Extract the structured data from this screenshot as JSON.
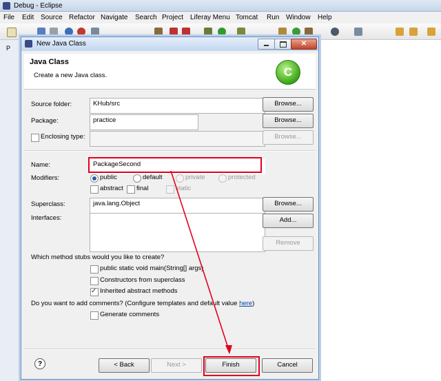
{
  "window": {
    "title": "Debug - Eclipse",
    "menu": [
      "File",
      "Edit",
      "Source",
      "Refactor",
      "Navigate",
      "Search",
      "Project",
      "Liferay Menu",
      "Tomcat",
      "Run",
      "Window",
      "Help"
    ],
    "left_tab_label": "P"
  },
  "dialog": {
    "title": "New Java Class",
    "heading": "Java Class",
    "subheading": "Create a new Java class.",
    "source_folder": {
      "label": "Source folder:",
      "value": "KHub/src",
      "button": "Browse..."
    },
    "package": {
      "label": "Package:",
      "value": "practice",
      "button": "Browse..."
    },
    "enclosing_type": {
      "label": "Enclosing type:",
      "value": "",
      "button": "Browse...",
      "checked": false
    },
    "name": {
      "label": "Name:",
      "value": "PackageSecond"
    },
    "modifiers": {
      "label": "Modifiers:",
      "radios": [
        {
          "label": "public",
          "selected": true,
          "enabled": true
        },
        {
          "label": "default",
          "selected": false,
          "enabled": true
        },
        {
          "label": "private",
          "selected": false,
          "enabled": false
        },
        {
          "label": "protected",
          "selected": false,
          "enabled": false
        }
      ],
      "checks": [
        {
          "label": "abstract",
          "checked": false,
          "enabled": true
        },
        {
          "label": "final",
          "checked": false,
          "enabled": true
        },
        {
          "label": "static",
          "checked": false,
          "enabled": false
        }
      ]
    },
    "superclass": {
      "label": "Superclass:",
      "value": "java.lang.Object",
      "button": "Browse..."
    },
    "interfaces": {
      "label": "Interfaces:",
      "add_button": "Add...",
      "remove_button": "Remove"
    },
    "stubs": {
      "question": "Which method stubs would you like to create?",
      "options": [
        {
          "label": "public static void main(String[] args)",
          "checked": false
        },
        {
          "label": "Constructors from superclass",
          "checked": false
        },
        {
          "label": "Inherited abstract methods",
          "checked": true
        }
      ]
    },
    "comments": {
      "question": "Do you want to add comments? (Configure templates and default value ",
      "link": "here",
      "question_end": ")",
      "option": {
        "label": "Generate comments",
        "checked": false
      }
    },
    "buttons": {
      "help": "?",
      "back": "< Back",
      "next": "Next >",
      "finish": "Finish",
      "cancel": "Cancel"
    }
  },
  "annotation_color": "#e0001b"
}
